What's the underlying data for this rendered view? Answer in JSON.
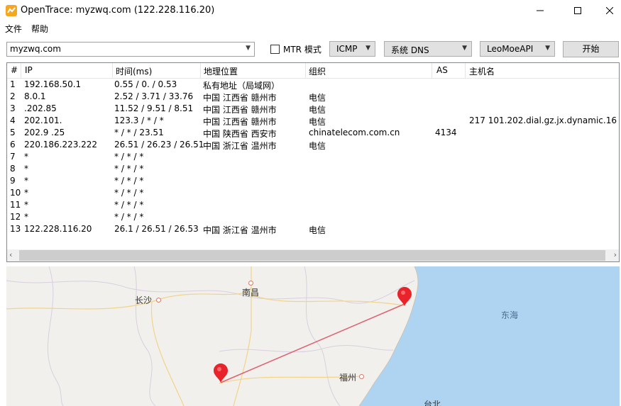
{
  "window": {
    "title": "OpenTrace: myzwq.com (122.228.116.20)",
    "minimize_glyph": "—",
    "maximize_glyph": "☐",
    "close_glyph": "✕"
  },
  "menu": [
    "文件",
    "帮助"
  ],
  "toolbar": {
    "host_value": "myzwq.com",
    "mtr_label": "MTR 模式",
    "mtr_checked": false,
    "protocol": "ICMP",
    "dns": "系统 DNS",
    "api": "LeoMoeAPI",
    "start_label": "开始"
  },
  "table": {
    "headers": [
      "#",
      "IP",
      "时间(ms)",
      "地理位置",
      "组织",
      "AS",
      "主机名"
    ],
    "rows": [
      {
        "num": "1",
        "ip": "192.168.50.1",
        "time": "0.55 / 0.  / 0.53",
        "geo": "私有地址（局域网）",
        "org": "",
        "as": "",
        "host": ""
      },
      {
        "num": "2",
        "ip": "   8.0.1",
        "time": "2.52 / 3.71 / 33.76",
        "geo": "中国 江西省 赣州市",
        "org": "电信",
        "as": "",
        "host": ""
      },
      {
        "num": "3",
        "ip": "   .202.85",
        "time": "11.52 / 9.51 / 8.51",
        "geo": "中国 江西省 赣州市",
        "org": "电信",
        "as": "",
        "host": ""
      },
      {
        "num": "4",
        "ip": "202.101.",
        "time": "123.3   / * / *",
        "geo": "中国 江西省 赣州市",
        "org": "电信",
        "as": "",
        "host": "217     101.202.dial.gz.jx.dynamic.16"
      },
      {
        "num": "5",
        "ip": "202.9   .25",
        "time": "* / * / 23.51",
        "geo": "中国 陕西省 西安市",
        "org": "chinatelecom.com.cn",
        "as": "4134",
        "host": ""
      },
      {
        "num": "6",
        "ip": "220.186.223.222",
        "time": "26.51 / 26.23 / 26.51",
        "geo": "中国 浙江省 温州市",
        "org": "电信",
        "as": "",
        "host": ""
      },
      {
        "num": "7",
        "ip": "*",
        "time": "* / * / *",
        "geo": "",
        "org": "",
        "as": "",
        "host": ""
      },
      {
        "num": "8",
        "ip": "*",
        "time": "* / * / *",
        "geo": "",
        "org": "",
        "as": "",
        "host": ""
      },
      {
        "num": "9",
        "ip": "*",
        "time": "* / * / *",
        "geo": "",
        "org": "",
        "as": "",
        "host": ""
      },
      {
        "num": "10",
        "ip": "*",
        "time": "* / * / *",
        "geo": "",
        "org": "",
        "as": "",
        "host": ""
      },
      {
        "num": "11",
        "ip": "*",
        "time": "* / * / *",
        "geo": "",
        "org": "",
        "as": "",
        "host": ""
      },
      {
        "num": "12",
        "ip": "*",
        "time": "* / * / *",
        "geo": "",
        "org": "",
        "as": "",
        "host": ""
      },
      {
        "num": "13",
        "ip": "122.228.116.20",
        "time": "26.1   / 26.51 / 26.53",
        "geo": "中国 浙江省 温州市",
        "org": "电信",
        "as": "",
        "host": ""
      }
    ]
  },
  "map": {
    "labels": [
      "长沙",
      "南昌",
      "福州",
      "东海",
      "台北"
    ],
    "marker_color": "#e8232a",
    "route_color": "#e06070",
    "sea_color": "#aed4f2",
    "land_color": "#f2f0ec"
  }
}
